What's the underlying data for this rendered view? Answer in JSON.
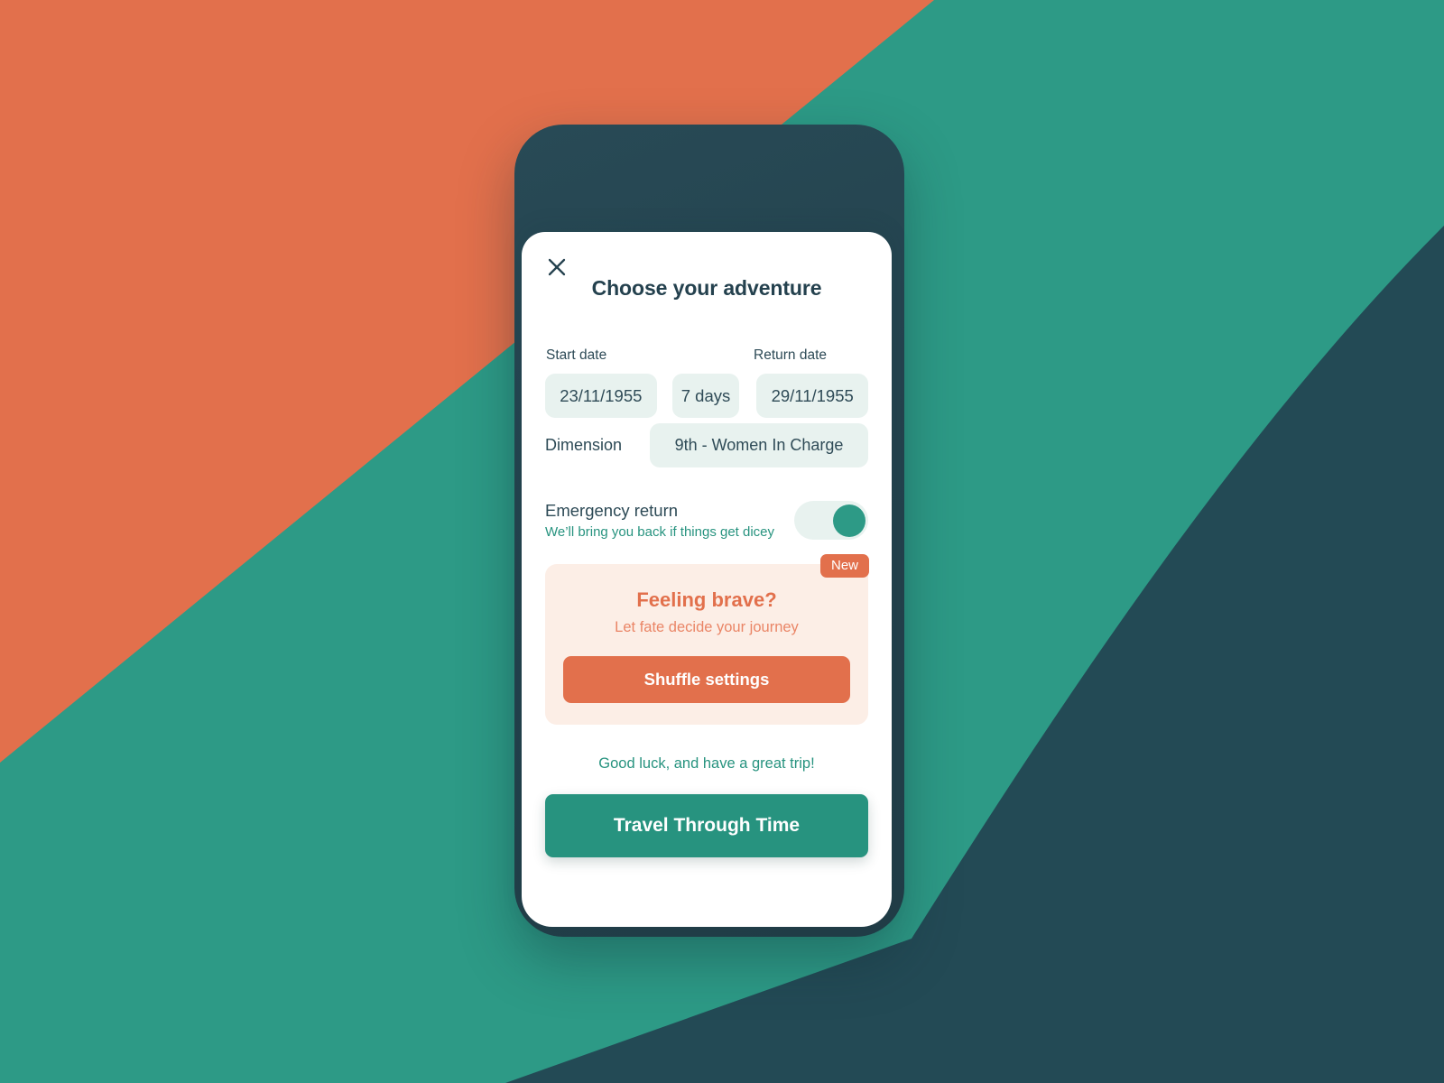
{
  "theme": {
    "orange": "#e2704c",
    "teal": "#2d9a86",
    "teal_dark": "#27937f",
    "navy": "#24414e",
    "pill_bg": "#e8f2ef",
    "card_bg": "#fceee6",
    "white": "#ffffff"
  },
  "sheet": {
    "close_icon": "close-icon",
    "title": "Choose your adventure"
  },
  "dates": {
    "start_label": "Start date",
    "return_label": "Return date",
    "start_value": "23/11/1955",
    "duration_value": "7 days",
    "return_value": "29/11/1955"
  },
  "dimension": {
    "label": "Dimension",
    "value": "9th - Women In Charge"
  },
  "emergency": {
    "title": "Emergency return",
    "subtitle": "We’ll bring you back if things get dicey",
    "enabled": true
  },
  "brave_card": {
    "badge": "New",
    "title": "Feeling brave?",
    "subtitle": "Let fate decide your journey",
    "button_label": "Shuffle settings"
  },
  "footer": {
    "note": "Good luck, and have a great trip!",
    "cta_label": "Travel Through Time"
  }
}
